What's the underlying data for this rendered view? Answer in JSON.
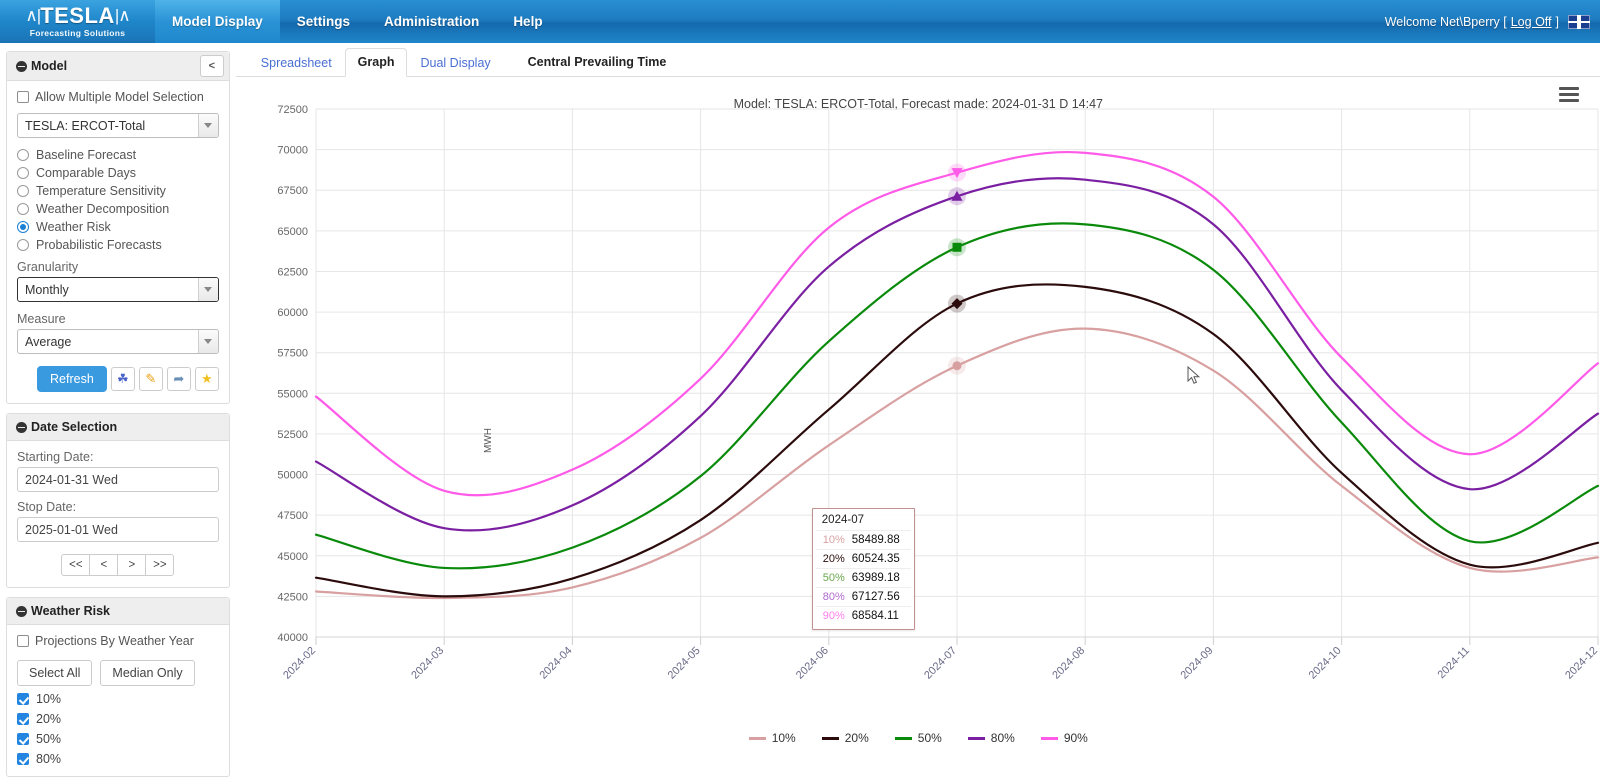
{
  "topbar": {
    "brand_word": "TESLA",
    "brand_tagline": "Forecasting Solutions",
    "nav": [
      {
        "label": "Model Display",
        "active": true
      },
      {
        "label": "Settings",
        "active": false
      },
      {
        "label": "Administration",
        "active": false
      },
      {
        "label": "Help",
        "active": false
      }
    ],
    "welcome_prefix": "Welcome Net\\Bperry [",
    "logoff": "Log Off",
    "welcome_suffix": "]",
    "flag_icon": "uk-flag-icon"
  },
  "sidebar": {
    "model_panel": {
      "title": "Model",
      "collapse_label": "<",
      "allow_multiple_label": "Allow Multiple Model Selection",
      "allow_multiple_checked": false,
      "model_select_value": "TESLA: ERCOT-Total",
      "radios": [
        {
          "label": "Baseline Forecast",
          "selected": false
        },
        {
          "label": "Comparable Days",
          "selected": false
        },
        {
          "label": "Temperature Sensitivity",
          "selected": false
        },
        {
          "label": "Weather Decomposition",
          "selected": false
        },
        {
          "label": "Weather Risk",
          "selected": true
        },
        {
          "label": "Probabilistic Forecasts",
          "selected": false
        }
      ],
      "granularity_label": "Granularity",
      "granularity_value": "Monthly",
      "measure_label": "Measure",
      "measure_value": "Average",
      "refresh_label": "Refresh",
      "icon_buttons": [
        {
          "name": "tree-icon",
          "glyph": "☘"
        },
        {
          "name": "pencil-icon",
          "glyph": "✎"
        },
        {
          "name": "share-icon",
          "glyph": "➦"
        },
        {
          "name": "star-icon",
          "glyph": "★"
        }
      ]
    },
    "date_panel": {
      "title": "Date Selection",
      "starting_date_label": "Starting Date:",
      "starting_date_value": "2024-01-31 Wed",
      "stop_date_label": "Stop Date:",
      "stop_date_value": "2025-01-01 Wed",
      "nav_buttons": [
        "<<",
        "<",
        ">",
        ">>"
      ]
    },
    "weather_risk_panel": {
      "title": "Weather Risk",
      "projections_label": "Projections By Weather Year",
      "projections_checked": false,
      "select_all_label": "Select All",
      "median_only_label": "Median Only",
      "percentiles": [
        {
          "label": "10%",
          "checked": true
        },
        {
          "label": "20%",
          "checked": true
        },
        {
          "label": "50%",
          "checked": true
        },
        {
          "label": "80%",
          "checked": true
        }
      ]
    }
  },
  "main": {
    "tabs": [
      {
        "label": "Spreadsheet",
        "active": false
      },
      {
        "label": "Graph",
        "active": true
      },
      {
        "label": "Dual Display",
        "active": false
      }
    ],
    "central_prevailing_time": "Central Prevailing Time",
    "menu_icon": "hamburger-menu-icon"
  },
  "tooltip": {
    "header": "2024-07",
    "rows": [
      {
        "key": "10%",
        "value": "58489.88",
        "color": "#d8a0a0"
      },
      {
        "key": "20%",
        "value": "60524.35",
        "color": "#2b0b0b"
      },
      {
        "key": "50%",
        "value": "63989.18",
        "color": "#7cb87c"
      },
      {
        "key": "80%",
        "value": "67127.56",
        "color": "#b06ad0"
      },
      {
        "key": "90%",
        "value": "68584.11",
        "color": "#ff7ef0"
      }
    ]
  },
  "chart_data": {
    "type": "line",
    "title": "Model: TESLA: ERCOT-Total, Forecast made: 2024-01-31 D 14:47",
    "xlabel": "",
    "ylabel": "MWH",
    "ylim": [
      40000,
      72500
    ],
    "ytick_step": 2500,
    "yticks": [
      40000,
      42500,
      45000,
      47500,
      50000,
      52500,
      55000,
      57500,
      60000,
      62500,
      65000,
      67500,
      70000,
      72500
    ],
    "grid": true,
    "legend_position": "bottom",
    "categories": [
      "2024-02",
      "2024-03",
      "2024-04",
      "2024-05",
      "2024-06",
      "2024-07",
      "2024-08",
      "2024-09",
      "2024-10",
      "2024-11",
      "2024-12"
    ],
    "series": [
      {
        "name": "10%",
        "color": "#d8a0a0",
        "marker": "circle",
        "values": [
          42800,
          42400,
          43050,
          46100,
          51800,
          56700,
          58980,
          56400,
          49300,
          44250,
          44900
        ]
      },
      {
        "name": "20%",
        "color": "#2b0b0b",
        "marker": "diamond",
        "values": [
          43650,
          42500,
          43600,
          47200,
          54000,
          60524,
          61550,
          58650,
          50100,
          44450,
          45800
        ]
      },
      {
        "name": "50%",
        "color": "#0a8a0a",
        "marker": "square",
        "values": [
          46300,
          44250,
          45500,
          49900,
          58200,
          63989,
          65400,
          62600,
          53200,
          45900,
          49300
        ]
      },
      {
        "name": "80%",
        "color": "#7b1fa2",
        "marker": "triangle-up",
        "values": [
          50800,
          46700,
          48100,
          53600,
          62800,
          67128,
          68150,
          65400,
          55200,
          49100,
          53750
        ]
      },
      {
        "name": "90%",
        "color": "#ff5ae8",
        "marker": "triangle-down",
        "values": [
          54800,
          49000,
          50300,
          55900,
          65200,
          68584,
          69800,
          67100,
          57200,
          51250,
          56850
        ]
      }
    ],
    "highlighted_category": "2024-07"
  },
  "legend": [
    {
      "label": "10%",
      "color": "#d8a0a0"
    },
    {
      "label": "20%",
      "color": "#2b0b0b"
    },
    {
      "label": "50%",
      "color": "#0a8a0a"
    },
    {
      "label": "80%",
      "color": "#7b1fa2"
    },
    {
      "label": "90%",
      "color": "#ff5ae8"
    }
  ]
}
